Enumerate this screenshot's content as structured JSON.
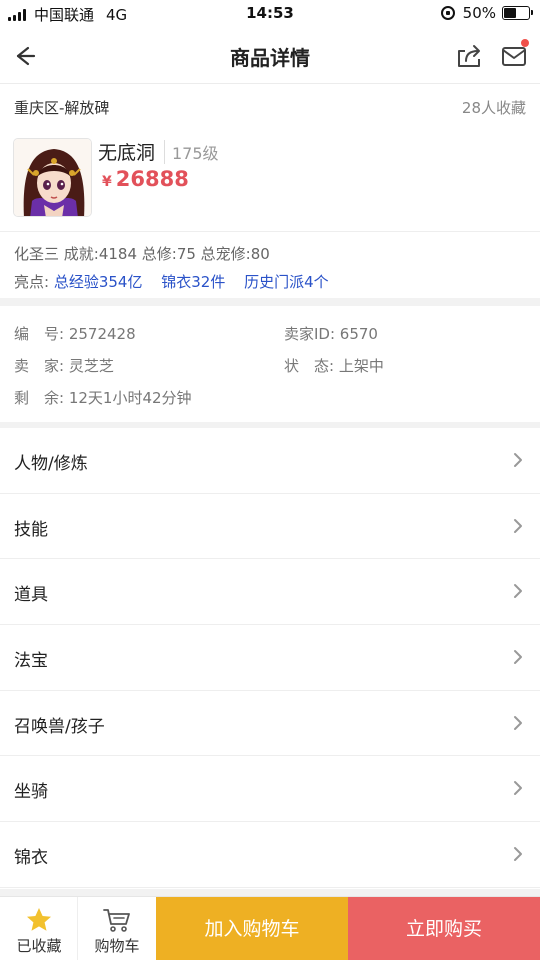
{
  "status_bar": {
    "carrier": "中国联通",
    "network": "4G",
    "time": "14:53",
    "battery": "50%",
    "battery_level": 0.5
  },
  "nav": {
    "title": "商品详情"
  },
  "location": {
    "server": "重庆区-解放碑",
    "favorites": "28人收藏"
  },
  "character": {
    "name": "无底洞",
    "level": "175级",
    "currency": "¥",
    "price": "26888",
    "stats": "化圣三 成就:4184 总修:75 总宠修:80",
    "highlights_label": "亮点:",
    "highlights": [
      "总经验354亿",
      "锦衣32件",
      "历史门派4个"
    ]
  },
  "info": {
    "id": "编　号: 2572428",
    "seller_id": "卖家ID: 6570",
    "seller": "卖　家: 灵芝芝",
    "status": "状　态: 上架中",
    "remaining": "剩　余: 12天1小时42分钟"
  },
  "menu": [
    {
      "label": "人物/修炼"
    },
    {
      "label": "技能"
    },
    {
      "label": "道具"
    },
    {
      "label": "法宝"
    },
    {
      "label": "召唤兽/孩子"
    },
    {
      "label": "坐骑"
    },
    {
      "label": "锦衣"
    }
  ],
  "bottom_bar": {
    "favorited_label": "已收藏",
    "cart_label": "购物车",
    "add_to_cart": "加入购物车",
    "buy_now": "立即购买"
  },
  "colors": {
    "price_red": "#e2515a",
    "highlight_blue": "#2a52c8",
    "add_cart_yellow": "#eeb023",
    "buy_now_red": "#ea6263",
    "star_yellow": "#f2c12e"
  },
  "icons": [
    "signal-icon",
    "lock-rotation-icon",
    "battery-icon",
    "back-arrow-icon",
    "share-icon",
    "mail-icon",
    "chevron-right-icon",
    "star-icon",
    "cart-icon"
  ]
}
